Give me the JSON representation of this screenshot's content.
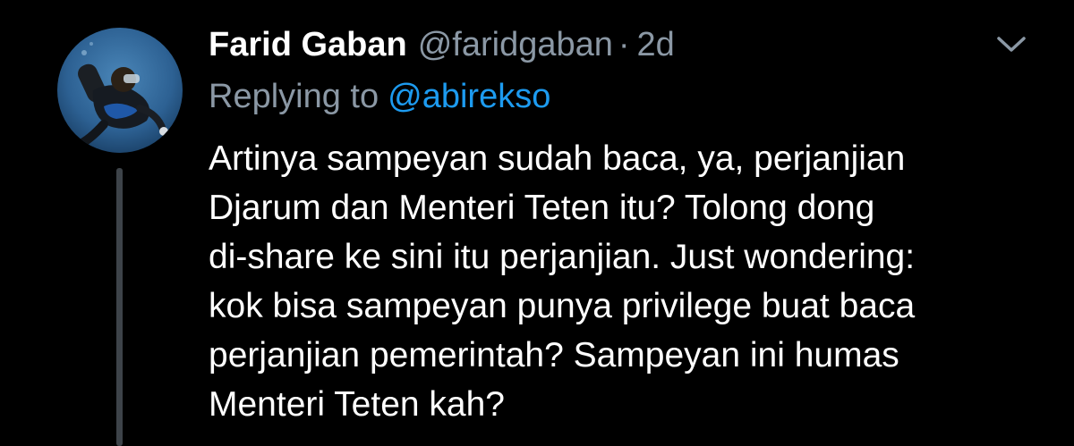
{
  "tweet": {
    "author_name": "Farid Gaban",
    "author_handle": "@faridgaban",
    "separator": "·",
    "timestamp": "2d",
    "reply_prefix": "Replying to",
    "reply_mention": "@abirekso",
    "body_lines": [
      "Artinya sampeyan sudah baca, ya, perjanjian",
      "Djarum dan Menteri Teten itu? Tolong dong",
      "di-share ke sini itu perjanjian. Just wondering:",
      "kok bisa sampeyan punya privilege buat baca",
      "perjanjian pemerintah? Sampeyan ini humas",
      "Menteri Teten kah?"
    ]
  },
  "icons": {
    "menu": "chevron-down-icon",
    "avatar": "avatar-scuba-diver"
  },
  "colors": {
    "background": "#000000",
    "text_primary": "#ffffff",
    "text_secondary": "#8b98a5",
    "accent": "#1d9bf0",
    "thread_line": "#3d4349"
  }
}
